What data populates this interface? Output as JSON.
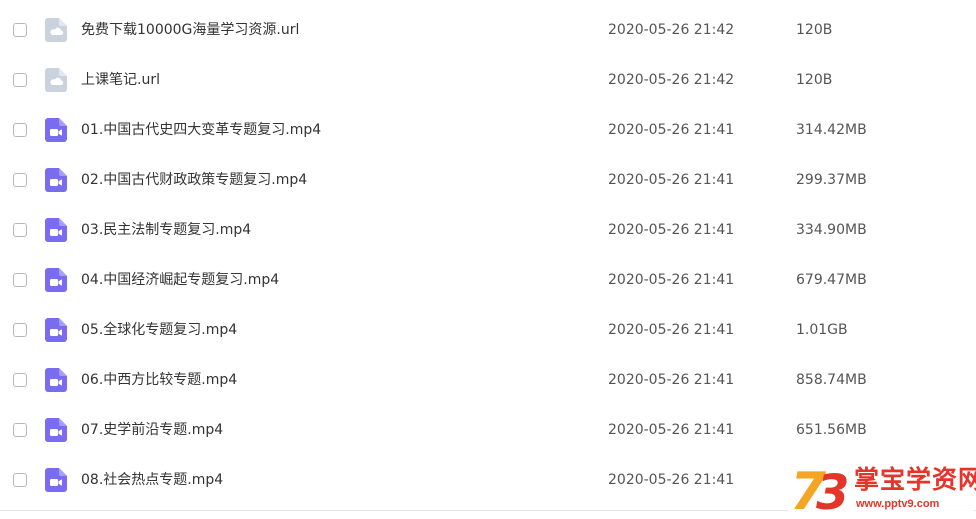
{
  "files": [
    {
      "name": "免费下载10000G海量学习资源.url",
      "date": "2020-05-26 21:42",
      "size": "120B",
      "icon": "url-file-icon"
    },
    {
      "name": "上课笔记.url",
      "date": "2020-05-26 21:42",
      "size": "120B",
      "icon": "url-file-icon"
    },
    {
      "name": "01.中国古代史四大变革专题复习.mp4",
      "date": "2020-05-26 21:41",
      "size": "314.42MB",
      "icon": "video-file-icon"
    },
    {
      "name": "02.中国古代财政政策专题复习.mp4",
      "date": "2020-05-26 21:41",
      "size": "299.37MB",
      "icon": "video-file-icon"
    },
    {
      "name": "03.民主法制专题复习.mp4",
      "date": "2020-05-26 21:41",
      "size": "334.90MB",
      "icon": "video-file-icon"
    },
    {
      "name": "04.中国经济崛起专题复习.mp4",
      "date": "2020-05-26 21:41",
      "size": "679.47MB",
      "icon": "video-file-icon"
    },
    {
      "name": "05.全球化专题复习.mp4",
      "date": "2020-05-26 21:41",
      "size": "1.01GB",
      "icon": "video-file-icon"
    },
    {
      "name": "06.中西方比较专题.mp4",
      "date": "2020-05-26 21:41",
      "size": "858.74MB",
      "icon": "video-file-icon"
    },
    {
      "name": "07.史学前沿专题.mp4",
      "date": "2020-05-26 21:41",
      "size": "651.56MB",
      "icon": "video-file-icon"
    },
    {
      "name": "08.社会热点专题.mp4",
      "date": "2020-05-26 21:41",
      "size": "",
      "icon": "video-file-icon"
    }
  ],
  "watermark": {
    "title": "掌宝学资网",
    "url": "www.pptv9.com",
    "logo_text": "73"
  },
  "colors": {
    "url_icon": "#c9d2dd",
    "video_icon": "#7a6cf0",
    "watermark_red": "#e5342a",
    "watermark_orange": "#f5a524"
  }
}
